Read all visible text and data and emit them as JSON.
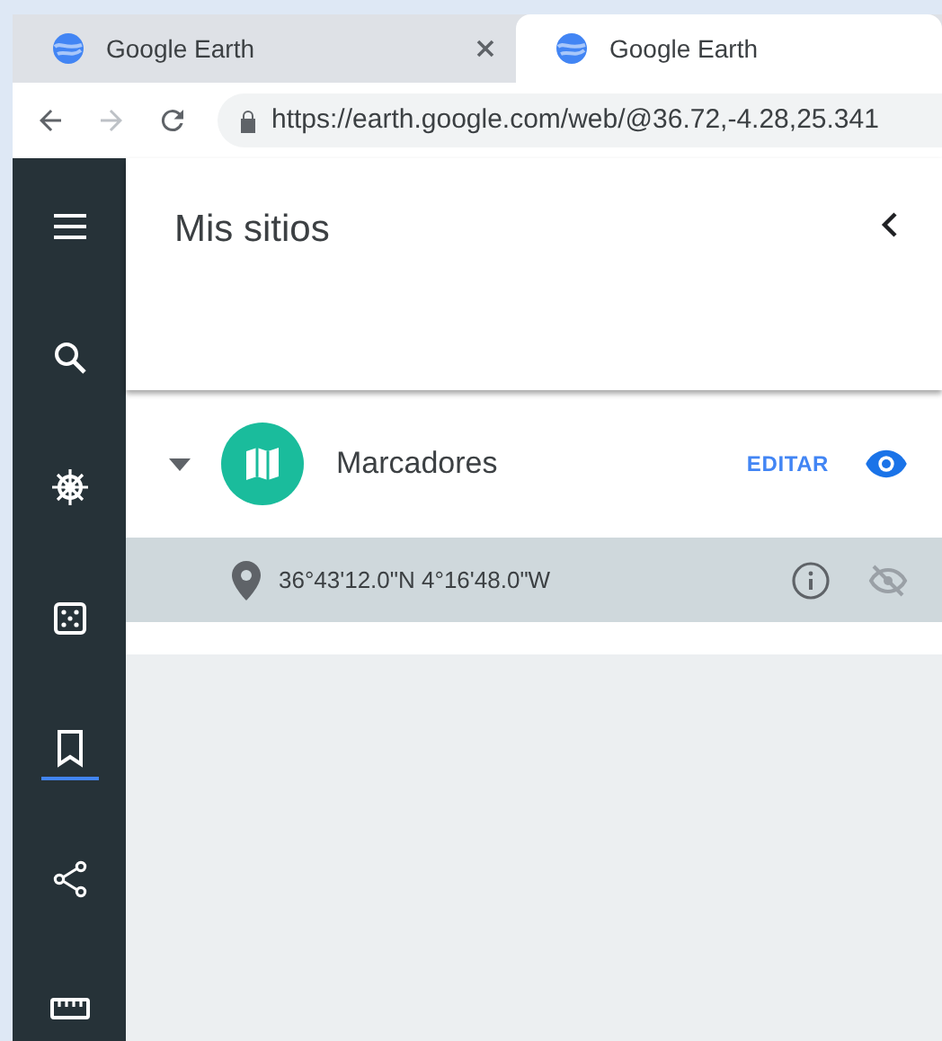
{
  "browser": {
    "tabs": [
      {
        "title": "Google Earth",
        "selected": false
      },
      {
        "title": "Google Earth",
        "selected": true
      }
    ],
    "url": "https://earth.google.com/web/@36.72,-4.28,25.341"
  },
  "sidebar": {
    "items": [
      {
        "kind": "menu",
        "selected": false
      },
      {
        "kind": "search",
        "selected": false
      },
      {
        "kind": "voyager",
        "selected": false
      },
      {
        "kind": "random",
        "selected": false
      },
      {
        "kind": "projects",
        "selected": true
      },
      {
        "kind": "share",
        "selected": false
      },
      {
        "kind": "measure",
        "selected": false
      }
    ]
  },
  "panel": {
    "title": "Mis sitios",
    "folder": {
      "name": "Marcadores",
      "expanded": true,
      "visible": true,
      "action": "EDITAR",
      "places": [
        {
          "name": "36°43'12.0\"N 4°16'48.0\"W",
          "selected": true,
          "visible": false
        }
      ]
    }
  }
}
